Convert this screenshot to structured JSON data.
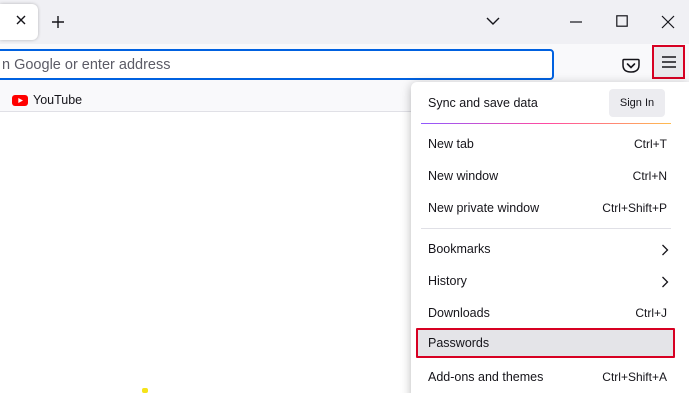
{
  "url_bar": {
    "placeholder": "n Google or enter address"
  },
  "bookmarks": [
    {
      "label": "YouTube"
    }
  ],
  "app_menu": {
    "sync_label": "Sync and save data",
    "sign_in_label": "Sign In",
    "items": [
      {
        "label": "New tab",
        "shortcut": "Ctrl+T"
      },
      {
        "label": "New window",
        "shortcut": "Ctrl+N"
      },
      {
        "label": "New private window",
        "shortcut": "Ctrl+Shift+P"
      },
      {
        "label": "Bookmarks",
        "submenu": true
      },
      {
        "label": "History",
        "submenu": true
      },
      {
        "label": "Downloads",
        "shortcut": "Ctrl+J"
      },
      {
        "label": "Passwords",
        "highlighted": true
      },
      {
        "label": "Add-ons and themes",
        "shortcut": "Ctrl+Shift+A"
      }
    ]
  },
  "colors": {
    "highlight_border": "#d70022",
    "focus_ring": "#0061e0",
    "youtube_red": "#ff0000"
  }
}
